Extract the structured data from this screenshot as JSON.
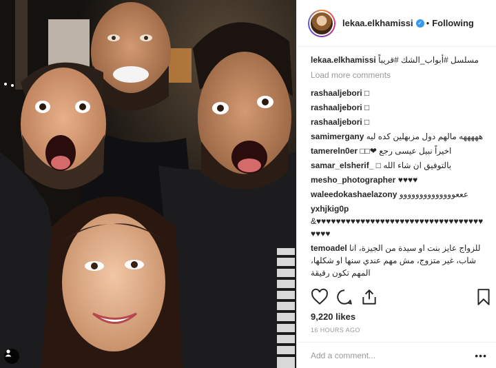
{
  "header": {
    "username": "lekaa.elkhamissi",
    "separator": "•",
    "follow_label": "Following"
  },
  "caption": {
    "user": "lekaa.elkhamissi",
    "text": "مسلسل #أبواب_الشك #قريباً"
  },
  "load_more": "Load more comments",
  "comments": [
    {
      "user": "rashaaljebori",
      "text": "□"
    },
    {
      "user": "rashaaljebori",
      "text": "□"
    },
    {
      "user": "rashaaljebori",
      "text": "□"
    },
    {
      "user": "samimergany",
      "text": "هههههه مالهم دول مزبهلين كده ليه"
    },
    {
      "user": "tamereln0er",
      "text": "اخيراً نبيل عيسى رجع ❤□□"
    },
    {
      "user": "samar_elsherif_",
      "text": "بالتوفيق ان شاء الله □"
    },
    {
      "user": "mesho_photographer",
      "text": "♥♥♥♥"
    },
    {
      "user": "waleedokashaelazony",
      "text": "عععوووووووووووووو"
    },
    {
      "user": "yxhjkig0p",
      "text": "&♥♥♥♥♥♥♥♥♥♥♥♥♥♥♥♥♥♥♥♥♥♥♥♥♥♥♥♥♥♥♥♥♥♥♥♥♥♥"
    },
    {
      "user": "temoadel",
      "text": "للزواج عايز بنت او سيدة من الجيزة، انا شاب، غير متزوج، مش مهم عندي سنها او شكلها، المهم تكون رقيقة"
    }
  ],
  "actions": {
    "like_icon": "heart-icon",
    "comment_icon": "comment-icon",
    "share_icon": "share-icon",
    "save_icon": "bookmark-icon"
  },
  "likes": "9,220 likes",
  "timestamp": "16 HOURS AGO",
  "add_comment": {
    "placeholder": "Add a comment...",
    "more_label": "•••"
  },
  "colors": {
    "verified": "#3897f0",
    "muted": "#999999",
    "text": "#262626",
    "border": "#efefef"
  }
}
